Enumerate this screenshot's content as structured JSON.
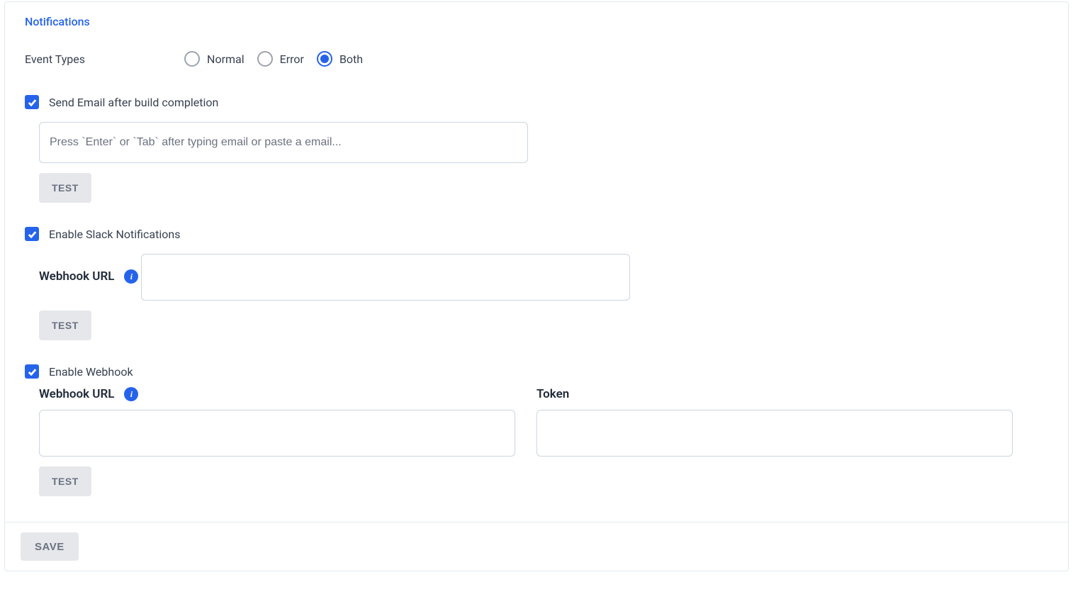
{
  "section_title": "Notifications",
  "event_types": {
    "label": "Event Types",
    "options": {
      "normal": "Normal",
      "error": "Error",
      "both": "Both"
    },
    "selected": "both"
  },
  "email": {
    "checkbox_label": "Send Email after build completion",
    "placeholder": "Press `Enter` or `Tab` after typing email or paste a email...",
    "test_button": "TEST"
  },
  "slack": {
    "checkbox_label": "Enable Slack Notifications",
    "webhook_label": "Webhook URL",
    "test_button": "TEST"
  },
  "webhook": {
    "checkbox_label": "Enable Webhook",
    "webhook_label": "Webhook URL",
    "token_label": "Token",
    "test_button": "TEST"
  },
  "save_button": "SAVE"
}
